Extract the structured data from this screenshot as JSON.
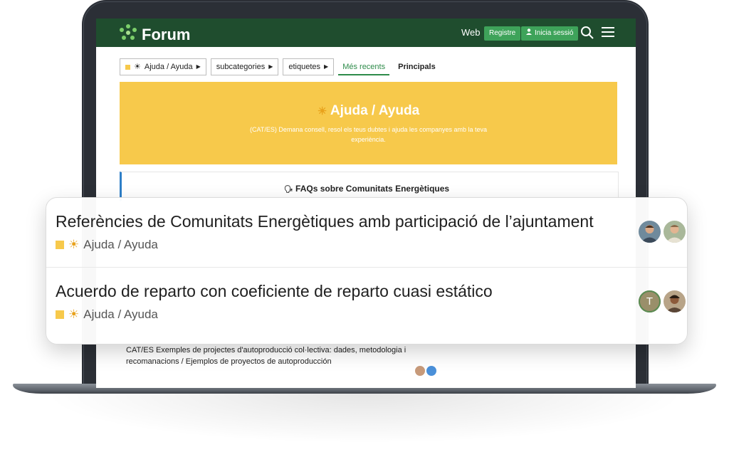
{
  "header": {
    "title": "Forum",
    "web_link": "Web",
    "register_label": "Registre",
    "login_label": "Inicia sessió"
  },
  "nav": {
    "category_dropdown": "Ajuda / Ayuda",
    "subcategories_dropdown": "subcategories",
    "tags_dropdown": "etiquetes",
    "tabs": [
      {
        "label": "Més recents",
        "active": true
      },
      {
        "label": "Principals",
        "active": false
      }
    ]
  },
  "banner": {
    "title": "Ajuda / Ayuda",
    "description": "(CAT/ES) Demana consell, resol els teus dubtes i ajuda les companyes amb la teva experiència.",
    "color": "#f7c94b"
  },
  "pinned": {
    "title": "FAQs sobre Comunitats Energètiques"
  },
  "background_topic": {
    "title": "CAT/ES Exemples de projectes d'autoproducció col·lectiva: dades, metodologia i recomanacions / Ejemplos de proyectos de autoproducción"
  },
  "overlay_topics": [
    {
      "title": "Referències de Comunitats Energètiques amb participació de l’ajuntament",
      "category": "Ajuda / Ayuda",
      "avatars": [
        "user-photo",
        "user-photo"
      ]
    },
    {
      "title": "Acuerdo de reparto con coeficiente de reparto cuasi estático",
      "category": "Ajuda / Ayuda",
      "avatars": [
        "T",
        "user-photo"
      ]
    }
  ],
  "colors": {
    "header_bg": "#1f4d2e",
    "accent_green": "#3ea35a",
    "category_yellow": "#f7c94b",
    "pinned_blue": "#2e7fc8"
  }
}
